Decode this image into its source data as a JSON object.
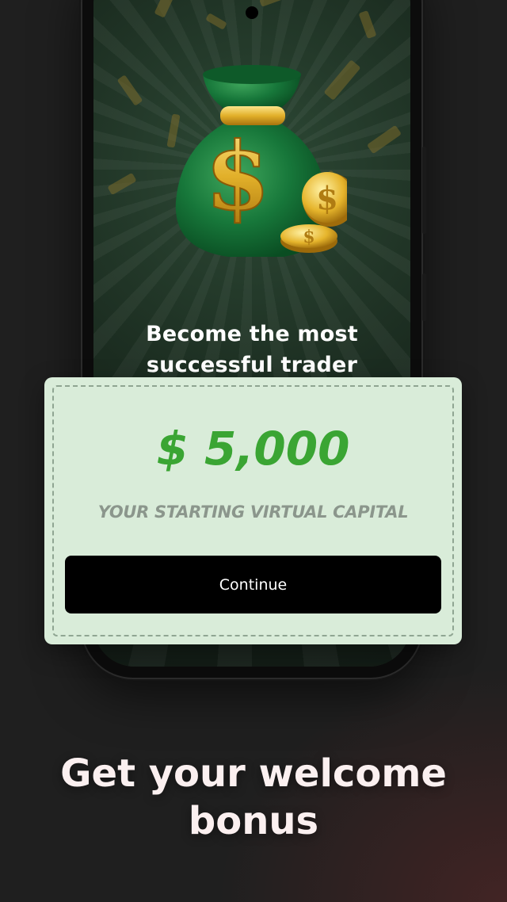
{
  "screen": {
    "headline": "Become the most successful trader"
  },
  "bonus_card": {
    "amount": "$ 5,000",
    "caption": "YOUR STARTING VIRTUAL CAPITAL",
    "continue_label": "Continue"
  },
  "promo": {
    "title": "Get your welcome bonus"
  },
  "colors": {
    "card_background": "#d9ecd9",
    "amount_green": "#3aa533",
    "button_background": "#000000",
    "page_background": "#1f1f1f"
  },
  "icons": {
    "illustration": "money-bag-icon",
    "coins": "coin-icon"
  }
}
